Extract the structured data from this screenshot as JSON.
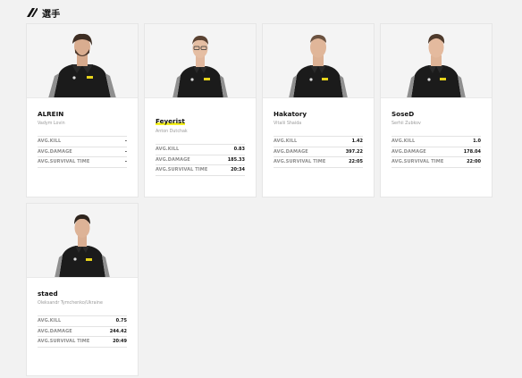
{
  "page": {
    "title": "選手",
    "accent_color": "#111111"
  },
  "players": [
    {
      "name": "ALREIN",
      "real_name": "Vadym Lovin",
      "stats": [
        {
          "label": "AVG.KILL",
          "value": "-"
        },
        {
          "label": "AVG.DAMAGE",
          "value": "-"
        },
        {
          "label": "AVG.SURVIVAL TIME",
          "value": "-"
        }
      ]
    },
    {
      "name": "Feyerist",
      "real_name": "Anton Dutchak",
      "highlighted": true,
      "stats": [
        {
          "label": "AVG.KILL",
          "value": "0.83"
        },
        {
          "label": "AVG.DAMAGE",
          "value": "185.33"
        },
        {
          "label": "AVG.SURVIVAL TIME",
          "value": "20:34"
        }
      ]
    },
    {
      "name": "Hakatory",
      "real_name": "Vitalii Shaida",
      "stats": [
        {
          "label": "AVG.KILL",
          "value": "1.42"
        },
        {
          "label": "AVG.DAMAGE",
          "value": "397.22"
        },
        {
          "label": "AVG.SURVIVAL TIME",
          "value": "22:05"
        }
      ]
    },
    {
      "name": "SoseD",
      "real_name": "Serhii Zubkov",
      "stats": [
        {
          "label": "AVG.KILL",
          "value": "1.0"
        },
        {
          "label": "AVG.DAMAGE",
          "value": "178.04"
        },
        {
          "label": "AVG.SURVIVAL TIME",
          "value": "22:00"
        }
      ]
    },
    {
      "name": "staed",
      "real_name": "Oleksandr Tymchenko/Ukraine",
      "stats": [
        {
          "label": "AVG.KILL",
          "value": "0.75"
        },
        {
          "label": "AVG.DAMAGE",
          "value": "244.42"
        },
        {
          "label": "AVG.SURVIVAL TIME",
          "value": "20:49"
        }
      ]
    }
  ]
}
